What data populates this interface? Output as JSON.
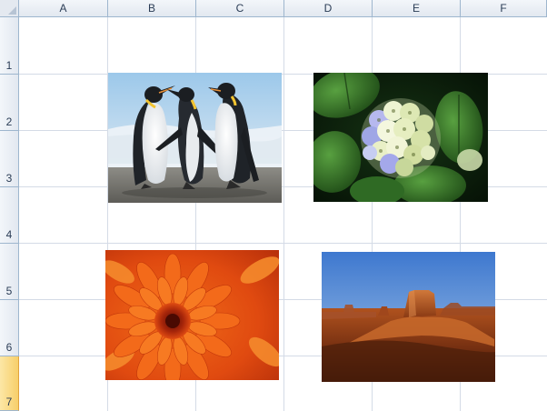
{
  "columns": [
    "A",
    "B",
    "C",
    "D",
    "E",
    "F"
  ],
  "rows": [
    "1",
    "2",
    "3",
    "4",
    "5",
    "6",
    "7"
  ],
  "active_row": "7",
  "pictures": [
    "penguins",
    "hydrangea",
    "chrysanthemum",
    "desert"
  ],
  "colors": {
    "header_border": "#9eb6ce",
    "gridline": "#d4dbe6",
    "active_row_header": "#f7cf6a"
  }
}
